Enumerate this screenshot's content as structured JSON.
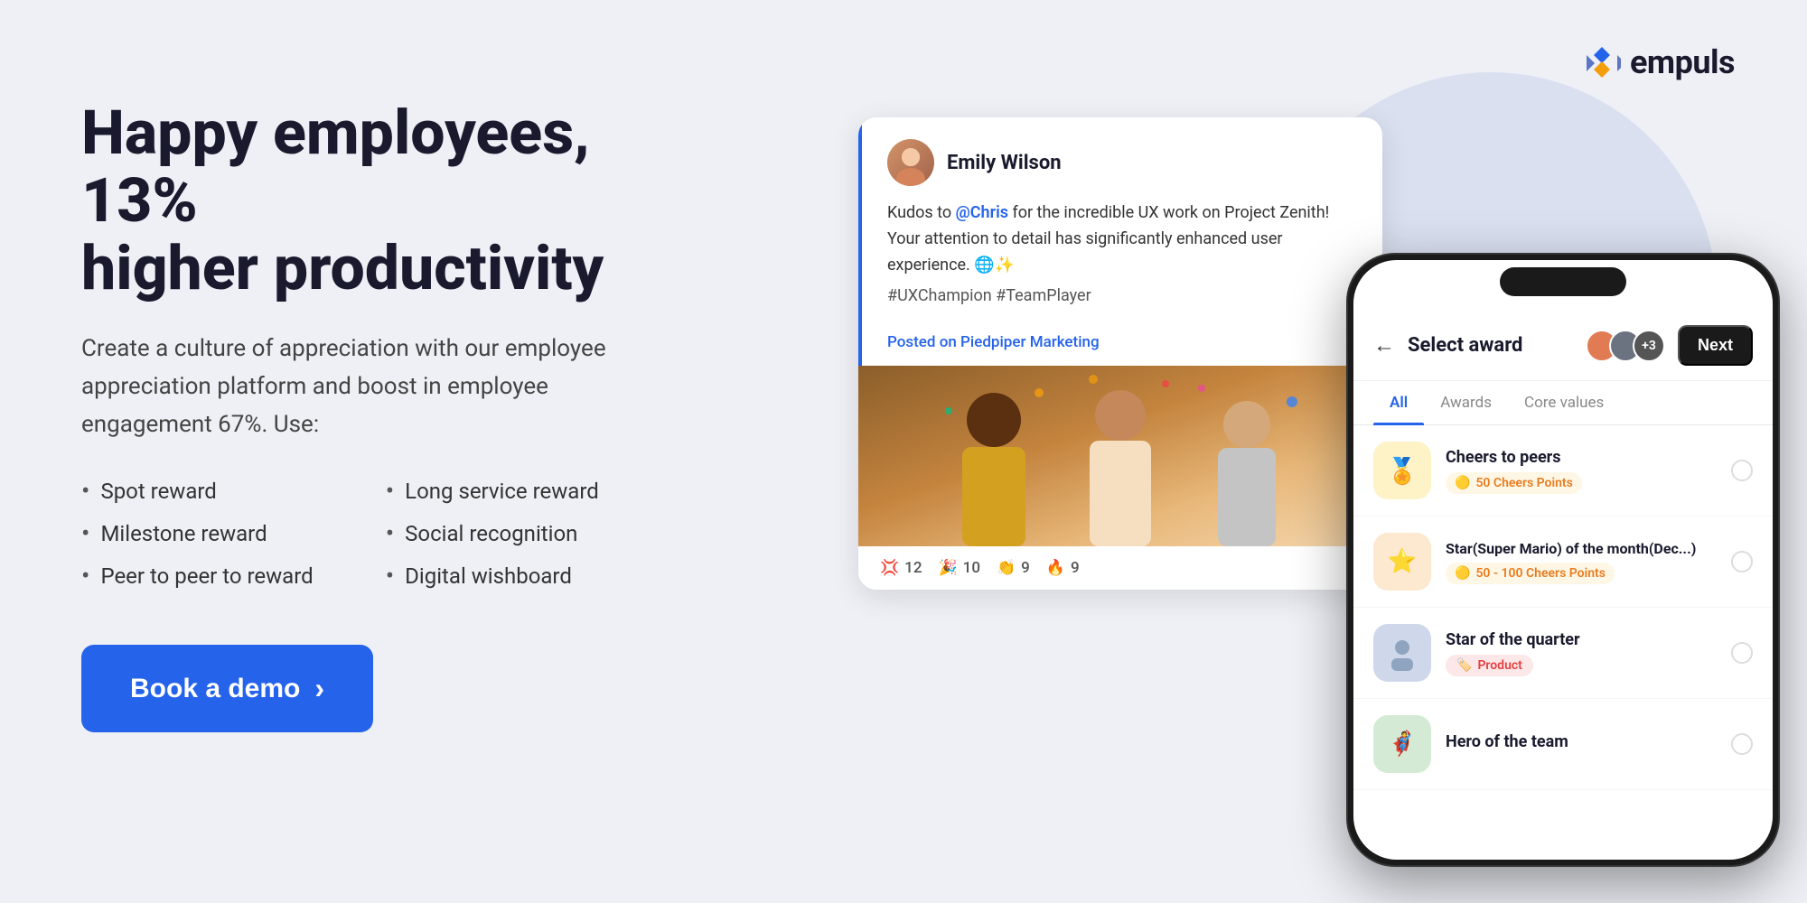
{
  "logo": {
    "text": "empuls"
  },
  "hero": {
    "headline": "Happy employees, 13%\nhigher productivity",
    "subtext": "Create a culture of appreciation with our employee appreciation platform and boost in employee engagement 67%. Use:",
    "bullets_col1": [
      "Spot reward",
      "Milestone reward",
      "Peer to peer to reward"
    ],
    "bullets_col2": [
      "Long service reward",
      "Social recognition",
      "Digital wishboard"
    ],
    "cta_label": "Book a demo",
    "cta_arrow": "›"
  },
  "post_card": {
    "poster_name": "Emily Wilson",
    "post_text_before": "Kudos to ",
    "post_mention": "@Chris",
    "post_text_after": " for the incredible UX work on Project Zenith! Your attention to detail has significantly enhanced user experience. 🌐✨",
    "post_hashtags": "#UXChampion #TeamPlayer",
    "posted_on_label": "Posted on",
    "posted_on_channel": "Piedpiper Marketing",
    "reactions": [
      {
        "emoji": "🔥",
        "count": "12"
      },
      {
        "emoji": "🎉",
        "count": "10"
      },
      {
        "emoji": "👏",
        "count": "9"
      },
      {
        "emoji": "🔥",
        "count": "9"
      }
    ]
  },
  "phone": {
    "header": {
      "back": "←",
      "title": "Select award",
      "next_label": "Next"
    },
    "tabs": [
      "All",
      "Awards",
      "Core values"
    ],
    "active_tab": "All",
    "awards": [
      {
        "id": "cheers",
        "name": "Cheers to peers",
        "points_label": "50 Cheers Points",
        "icon_emoji": "🏅",
        "icon_bg": "#fef3c7",
        "type": "points"
      },
      {
        "id": "mario",
        "name": "Star(Super Mario) of the month(Dec...)",
        "points_label": "50 - 100 Cheers Points",
        "icon_emoji": "⭐",
        "icon_bg": "#fde8d0",
        "type": "range"
      },
      {
        "id": "quarter",
        "name": "Star of the quarter",
        "tag_label": "Product",
        "icon_emoji": "👤",
        "icon_bg": "#e0e7ef",
        "type": "tag"
      },
      {
        "id": "hero",
        "name": "Hero of the team",
        "icon_emoji": "🦸",
        "icon_bg": "#e8f0e0",
        "type": "none"
      }
    ]
  }
}
